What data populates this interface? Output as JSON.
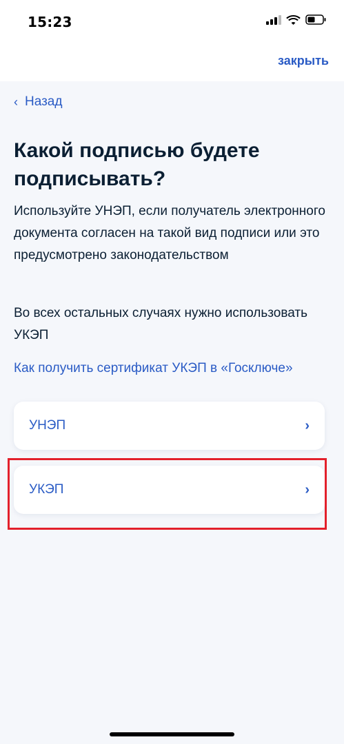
{
  "status_bar": {
    "time": "15:23"
  },
  "header": {
    "close_label": "закрыть"
  },
  "nav": {
    "back_label": "Назад"
  },
  "main": {
    "title": "Какой подписью будете подписывать?",
    "description_1": "Используйте УНЭП, если получатель электронного документа согласен на такой вид подписи или это предусмотрено законодательством",
    "description_2": "Во всех остальных случаях нужно использовать УКЭП",
    "cert_link": "Как получить сертификат УКЭП в «Госключе»",
    "options": [
      {
        "label": "УНЭП"
      },
      {
        "label": "УКЭП"
      }
    ]
  },
  "colors": {
    "accent": "#2a5bc5",
    "text": "#0b1f33",
    "background": "#f5f7fb",
    "highlight": "#e3202b"
  }
}
